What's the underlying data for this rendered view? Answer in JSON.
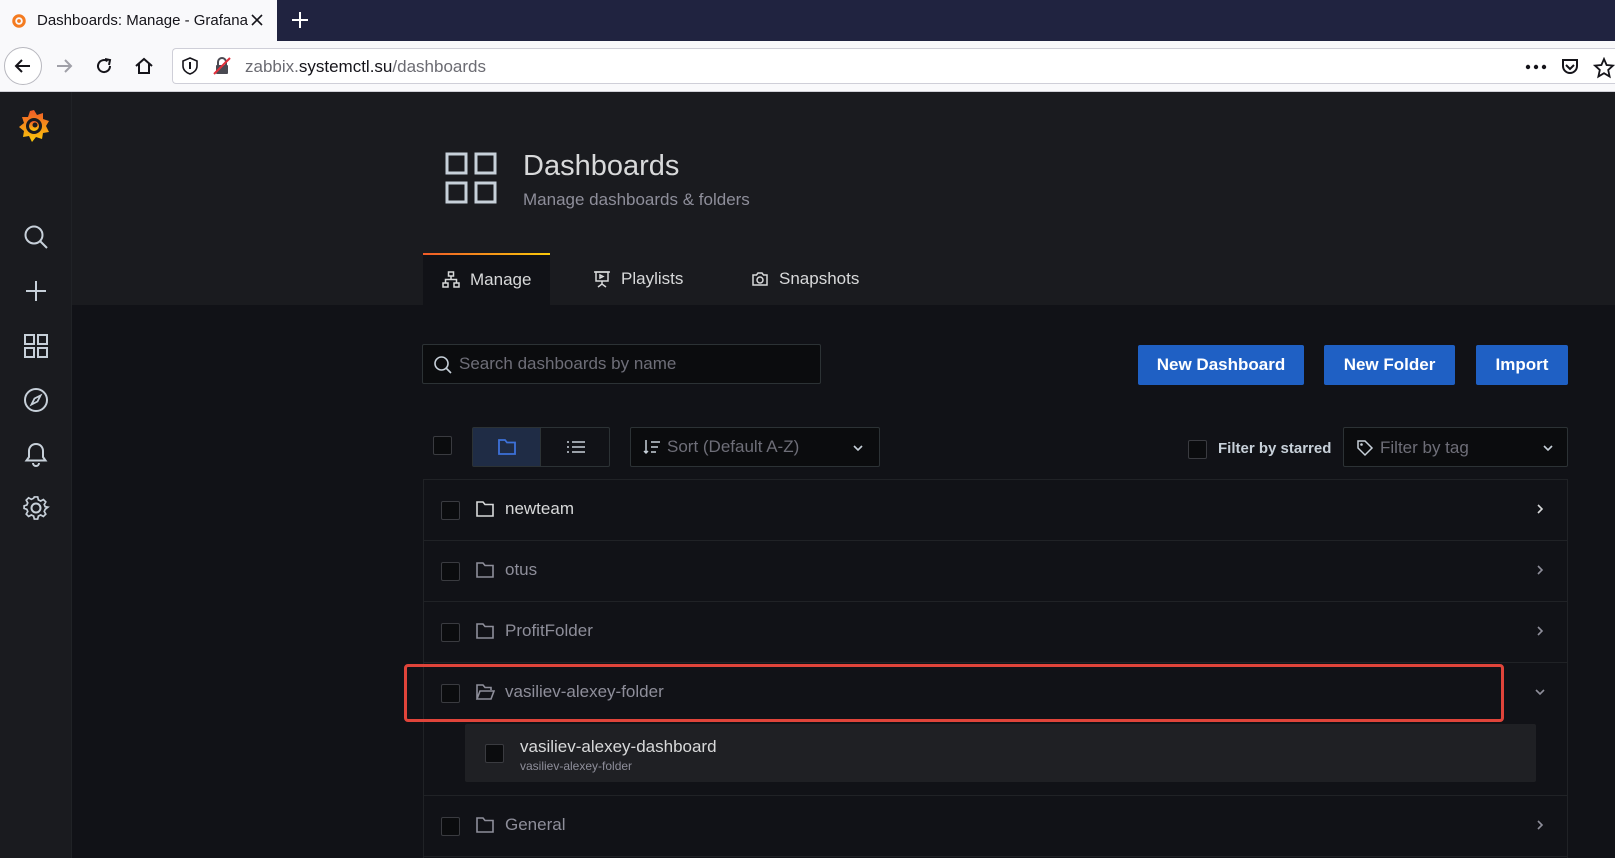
{
  "browser": {
    "tab_title": "Dashboards: Manage - Grafana",
    "url_prefix": "zabbix.",
    "url_host": "systemctl.su",
    "url_path": "/dashboards"
  },
  "sidebar": {
    "items": [
      {
        "name": "search-icon"
      },
      {
        "name": "plus-icon"
      },
      {
        "name": "dashboards-icon"
      },
      {
        "name": "compass-icon"
      },
      {
        "name": "bell-icon"
      },
      {
        "name": "gear-icon"
      }
    ]
  },
  "header": {
    "title": "Dashboards",
    "subtitle": "Manage dashboards & folders"
  },
  "tabs": [
    {
      "label": "Manage",
      "icon": "sitemap-icon",
      "active": true
    },
    {
      "label": "Playlists",
      "icon": "presentation-icon",
      "active": false
    },
    {
      "label": "Snapshots",
      "icon": "camera-icon",
      "active": false
    }
  ],
  "toolbar": {
    "search_placeholder": "Search dashboards by name",
    "new_dashboard": "New Dashboard",
    "new_folder": "New Folder",
    "import": "Import"
  },
  "filters": {
    "sort_placeholder": "Sort (Default A-Z)",
    "starred_label": "Filter by starred",
    "tag_placeholder": "Filter by tag"
  },
  "folders": [
    {
      "title": "newteam",
      "expanded": false
    },
    {
      "title": "otus",
      "expanded": false
    },
    {
      "title": "ProfitFolder",
      "expanded": false
    },
    {
      "title": "vasiliev-alexey-folder",
      "expanded": true
    },
    {
      "title": "General",
      "expanded": false
    }
  ],
  "expanded_dashboard": {
    "title": "vasiliev-alexey-dashboard",
    "folder": "vasiliev-alexey-folder"
  },
  "colors": {
    "primary_button": "#1f60c4",
    "highlight": "#e0443a",
    "accent_gradient_start": "#f05a28",
    "accent_gradient_end": "#fbca0a"
  }
}
